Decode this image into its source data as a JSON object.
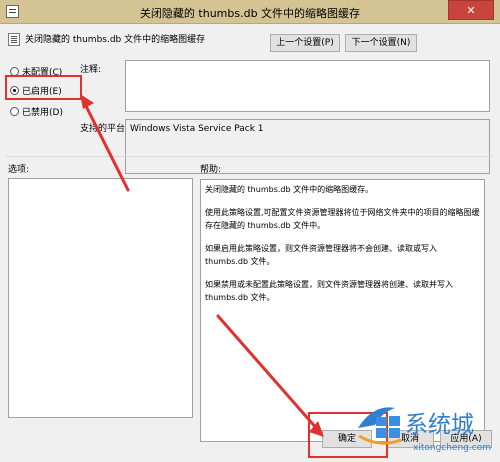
{
  "window": {
    "title": "关闭隐藏的 thumbs.db 文件中的缩略图缓存",
    "close_glyph": "✕"
  },
  "policy": {
    "name": "关闭隐藏的 thumbs.db 文件中的缩略图缓存",
    "prev_button": "上一个设置(P)",
    "next_button": "下一个设置(N)"
  },
  "options": {
    "not_configured": "未配置(C)",
    "enabled": "已启用(E)",
    "disabled": "已禁用(D)",
    "selected": "enabled"
  },
  "comment": {
    "label": "注释:",
    "value": ""
  },
  "supported": {
    "label": "支持的平台:",
    "value": "Windows Vista Service Pack 1"
  },
  "sections": {
    "options_label": "选项:",
    "help_label": "帮助:"
  },
  "help": {
    "p1": "关闭隐藏的 thumbs.db 文件中的缩略图缓存。",
    "p2": "使用此策略设置,可配置文件资源管理器将位于网络文件夹中的项目的缩略图缓存在隐藏的 thumbs.db 文件中。",
    "p3": "如果启用此策略设置，则文件资源管理器将不会创建、读取或写入 thumbs.db 文件。",
    "p4": "如果禁用或未配置此策略设置，则文件资源管理器将创建、读取并写入 thumbs.db 文件。"
  },
  "footer": {
    "ok_button": "确定",
    "cancel_button": "取消",
    "apply_button": "应用(A)"
  },
  "watermark": {
    "brand": "系统城",
    "url": "xitongcheng.com"
  },
  "colors": {
    "annotation_red": "#e03030",
    "title_bar": "#d4c494",
    "close_button": "#c7453d",
    "watermark_blue": "#2f7fd0"
  }
}
